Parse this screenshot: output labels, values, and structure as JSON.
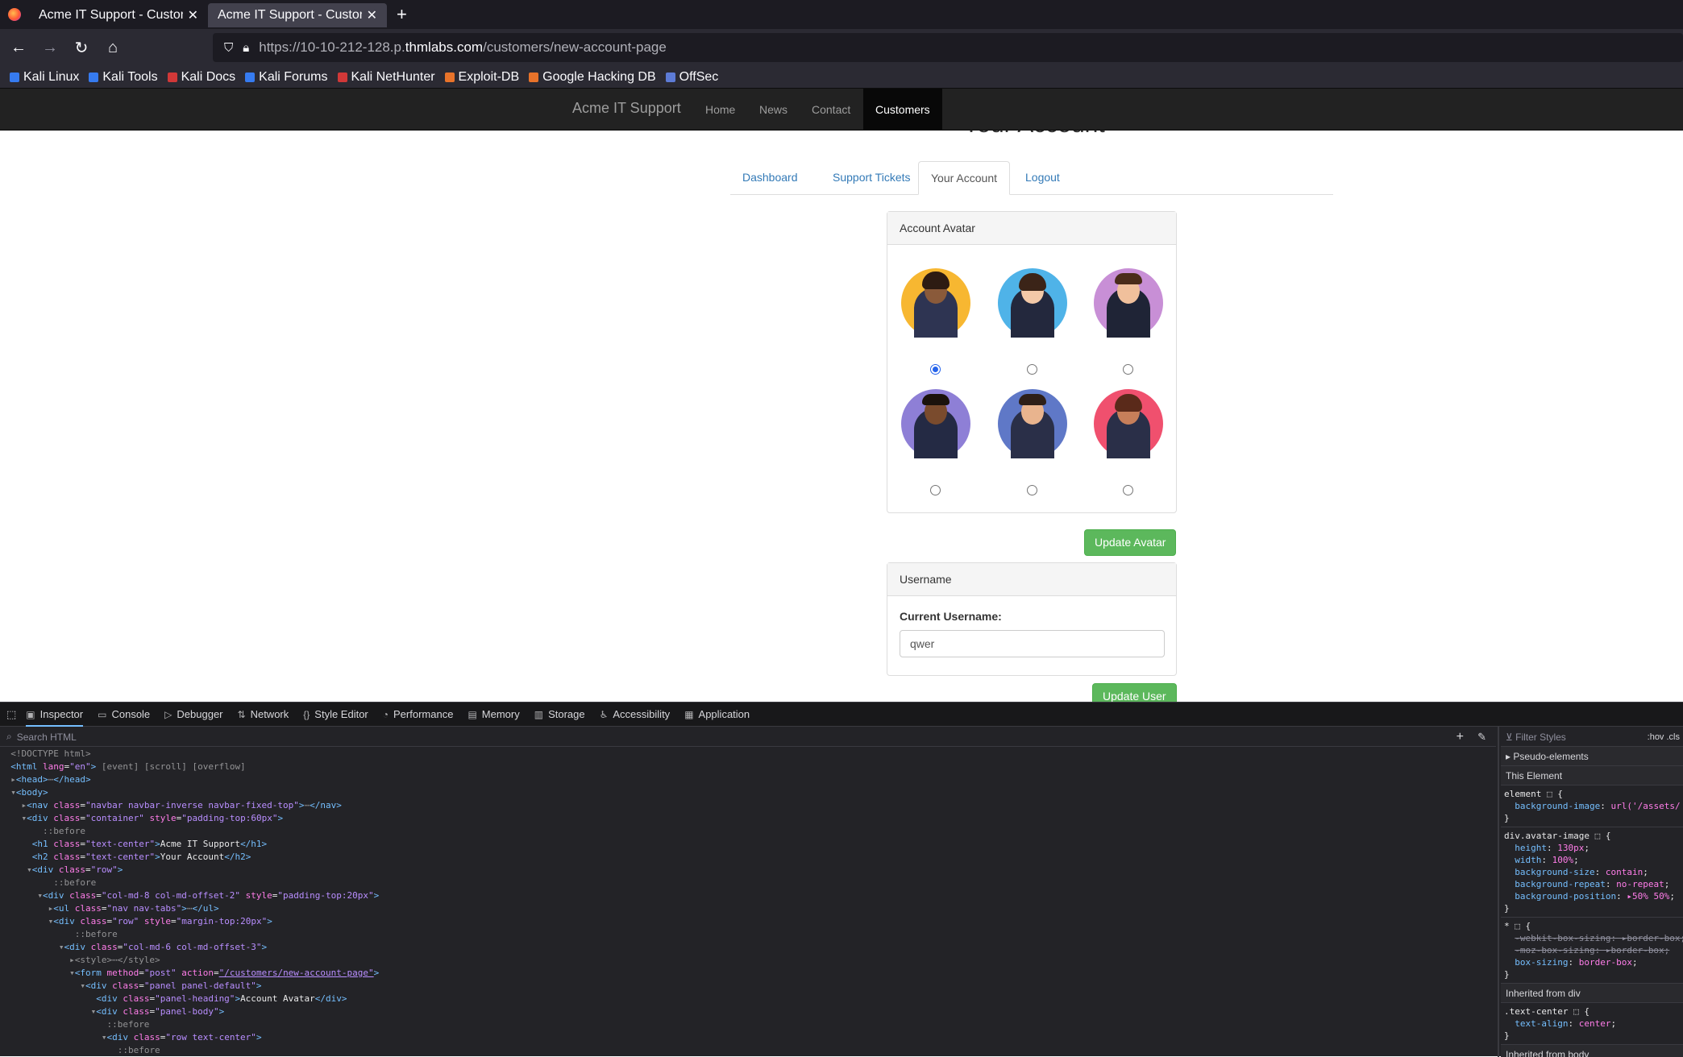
{
  "browser": {
    "tabs": [
      {
        "title": "Acme IT Support - Customers",
        "active": false
      },
      {
        "title": "Acme IT Support - Customers",
        "active": true
      }
    ],
    "url": {
      "prefix": "https://10-10-212-128.p.",
      "domain": "thmlabs.com",
      "path": "/customers/new-account-page"
    },
    "bookmarks": [
      "Kali Linux",
      "Kali Tools",
      "Kali Docs",
      "Kali Forums",
      "Kali NetHunter",
      "Exploit-DB",
      "Google Hacking DB",
      "OffSec"
    ]
  },
  "site": {
    "brand": "Acme IT Support",
    "nav": [
      "Home",
      "News",
      "Contact",
      "Customers"
    ],
    "active_nav": "Customers",
    "heading": "Your Account",
    "tabs": [
      "Dashboard",
      "Support Tickets",
      "Your Account",
      "Logout"
    ],
    "active_tab": "Your Account",
    "avatar_panel": {
      "heading": "Account Avatar",
      "avatars": [
        {
          "bg": "#f7b731",
          "selected": true
        },
        {
          "bg": "#4fb3e8",
          "selected": false
        },
        {
          "bg": "#c88fd6",
          "selected": false
        },
        {
          "bg": "#8e7fd6",
          "selected": false
        },
        {
          "bg": "#5f78c7",
          "selected": false
        },
        {
          "bg": "#f0506e",
          "selected": false
        }
      ],
      "button": "Update Avatar"
    },
    "username_panel": {
      "heading": "Username",
      "label": "Current Username:",
      "value": "qwer",
      "button": "Update User"
    }
  },
  "devtools": {
    "tabs": [
      "Inspector",
      "Console",
      "Debugger",
      "Network",
      "Style Editor",
      "Performance",
      "Memory",
      "Storage",
      "Accessibility",
      "Application"
    ],
    "search_placeholder": "Search HTML",
    "filter_placeholder": "Filter Styles",
    "filter_toggles": [
      ":hov",
      ".cls"
    ],
    "pseudo_elements": "Pseudo-elements",
    "this_element": "This Element",
    "inherited_div": "Inherited from div",
    "inherited_body": "Inherited from body"
  }
}
